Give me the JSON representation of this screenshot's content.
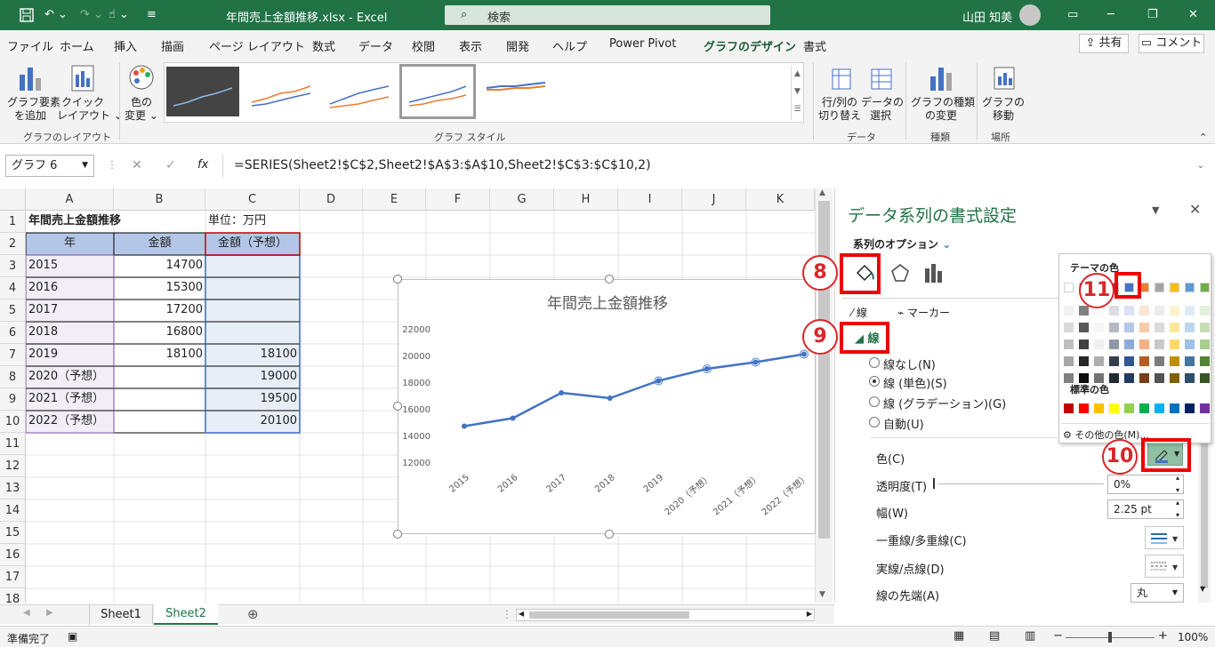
{
  "titlebar": {
    "filename": "年間売上金額推移.xlsx",
    "app": "Excel",
    "search_placeholder": "検索",
    "user": "山田 知美"
  },
  "menu": [
    "ファイル",
    "ホーム",
    "挿入",
    "描画",
    "ページ レイアウト",
    "数式",
    "データ",
    "校閲",
    "表示",
    "開発",
    "ヘルプ",
    "Power Pivot",
    "グラフのデザイン",
    "書式"
  ],
  "menu_active": "グラフのデザイン",
  "share_label": "共有",
  "comment_label": "コメント",
  "ribbon": {
    "add_element": [
      "グラフ要素",
      "を追加"
    ],
    "quick_layout": [
      "クイック",
      "レイアウト"
    ],
    "change_color": [
      "色の",
      "変更"
    ],
    "group_layout": "グラフのレイアウト",
    "group_styles": "グラフ スタイル",
    "switch_rowcol": [
      "行/列の",
      "切り替え"
    ],
    "select_data": [
      "データの",
      "選択"
    ],
    "group_data": "データ",
    "change_type": [
      "グラフの種類",
      "の変更"
    ],
    "group_type": "種類",
    "move_chart": [
      "グラフの",
      "移動"
    ],
    "group_location": "場所"
  },
  "formula": {
    "namebox": "グラフ 6",
    "fx": "fx",
    "text": "=SERIES(Sheet2!$C$2,Sheet2!$A$3:$A$10,Sheet2!$C$3:$C$10,2)"
  },
  "columns": [
    "A",
    "B",
    "C",
    "D",
    "E",
    "F",
    "G",
    "H",
    "I",
    "J",
    "K"
  ],
  "rows": [
    "1",
    "2",
    "3",
    "4",
    "5",
    "6",
    "7",
    "8",
    "9",
    "10",
    "11",
    "12",
    "13",
    "14",
    "15",
    "16",
    "17",
    "18"
  ],
  "cells": {
    "a1": "年間売上金額推移",
    "c1": "単位：万円",
    "a2": "年",
    "b2": "金額",
    "c2": "金額（予想）",
    "a3": "2015",
    "b3": "14700",
    "a4": "2016",
    "b4": "15300",
    "a5": "2017",
    "b5": "17200",
    "a6": "2018",
    "b6": "16800",
    "a7": "2019",
    "b7": "18100",
    "c7": "18100",
    "a8": "2020（予想）",
    "c8": "19000",
    "a9": "2021（予想）",
    "c9": "19500",
    "a10": "2022（予想）",
    "c10": "20100"
  },
  "chart_data": {
    "type": "line",
    "title": "年間売上金額推移",
    "categories": [
      "2015",
      "2016",
      "2017",
      "2018",
      "2019",
      "2020（予想）",
      "2021（予想）",
      "2022（予想）"
    ],
    "series": [
      {
        "values": [
          14700,
          15300,
          17200,
          16800,
          18100,
          null,
          null,
          null
        ],
        "color": "#4472c4"
      },
      {
        "values": [
          null,
          null,
          null,
          null,
          18100,
          19000,
          19500,
          20100
        ],
        "color": "#4472c4"
      }
    ],
    "yticks": [
      "12000",
      "14000",
      "16000",
      "18000",
      "20000",
      "22000"
    ],
    "ylim": [
      12000,
      22000
    ],
    "grid": false
  },
  "panel": {
    "title": "データ系列の書式設定",
    "series_options": "系列のオプション",
    "line_tab": "線",
    "marker_tab": "マーカー",
    "line_section": "線",
    "radios": [
      "線なし(N)",
      "線 (単色)(S)",
      "線 (グラデーション)(G)",
      "自動(U)"
    ],
    "color_label": "色(C)",
    "transparency_label": "透明度(T)",
    "transparency_value": "0%",
    "width_label": "幅(W)",
    "width_value": "2.25 pt",
    "compound_label": "一重線/多重線(C)",
    "dash_label": "実線/点線(D)",
    "cap_label": "線の先端(A)",
    "cap_value": "丸"
  },
  "popup": {
    "theme_colors": "テーマの色",
    "standard_colors": "標準の色",
    "more_colors": "その他の色(M)..."
  },
  "theme_top": [
    "#ffffff",
    "#000000",
    "#e7e6e6",
    "#44546a",
    "#4472c4",
    "#ed7d31",
    "#a5a5a5",
    "#ffc000",
    "#5b9bd5",
    "#70ad47"
  ],
  "standard": [
    "#c00000",
    "#ff0000",
    "#ffc000",
    "#ffff00",
    "#92d050",
    "#00b050",
    "#00b0f0",
    "#0070c0",
    "#002060",
    "#7030a0"
  ],
  "badges": {
    "b8": "8",
    "b9": "9",
    "b10": "10",
    "b11": "11"
  },
  "sheets": [
    "Sheet1",
    "Sheet2"
  ],
  "active_sheet": "Sheet2",
  "status": {
    "ready": "準備完了",
    "zoom": "100%"
  }
}
